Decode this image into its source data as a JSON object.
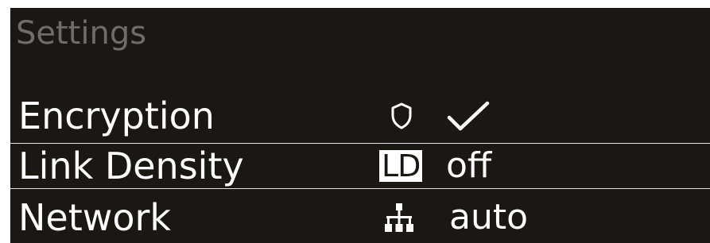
{
  "header": {
    "title": "Settings"
  },
  "rows": [
    {
      "label": "Encryption",
      "icon": "shield-icon",
      "value_icon": "checkmark-icon",
      "value": ""
    },
    {
      "label": "Link Density",
      "icon": "link-density-badge",
      "badge": "LD",
      "value": "off",
      "selected": true
    },
    {
      "label": "Network",
      "icon": "network-icon",
      "value": "auto"
    }
  ],
  "colors": {
    "background": "#1b1813",
    "title": "#6f6c6a",
    "text": "#ffffff",
    "selection_border": "#e5e5e5"
  }
}
